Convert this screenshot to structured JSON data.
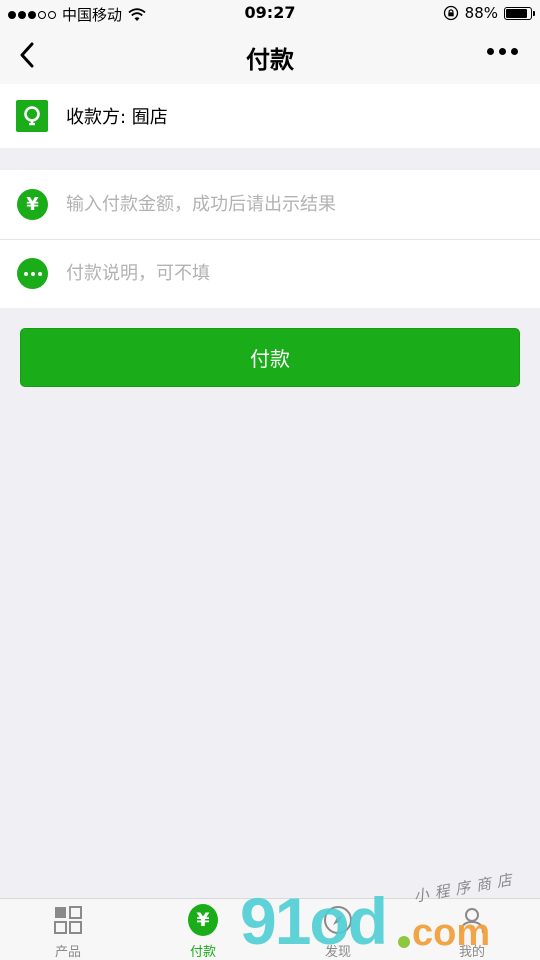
{
  "status_bar": {
    "carrier": "中国移动",
    "time": "09:27",
    "battery": "88%",
    "battery_level": 0.88
  },
  "nav": {
    "title": "付款"
  },
  "merchant": {
    "label": "收款方: 囿店"
  },
  "form": {
    "amount_placeholder": "输入付款金额，成功后请出示结果",
    "amount_value": "",
    "amount_icon": "yen-icon",
    "note_placeholder": "付款说明，可不填",
    "note_value": "",
    "note_icon": "ellipsis-icon"
  },
  "pay_button": {
    "label": "付款"
  },
  "tab_bar": {
    "tabs": [
      {
        "label": "产品",
        "icon": "grid-icon",
        "active": false
      },
      {
        "label": "付款",
        "icon": "yen-icon",
        "active": true
      },
      {
        "label": "发现",
        "icon": "compass-icon",
        "active": false
      },
      {
        "label": "我的",
        "icon": "person-icon",
        "active": false
      }
    ]
  },
  "watermark": {
    "main": "91od",
    "suffix": "com",
    "tagline": "小程序商店"
  },
  "colors": {
    "accent": "#1aad19",
    "background": "#efeff4",
    "placeholder": "#b2b2b2",
    "inactive_tab": "#8a8a8a"
  }
}
